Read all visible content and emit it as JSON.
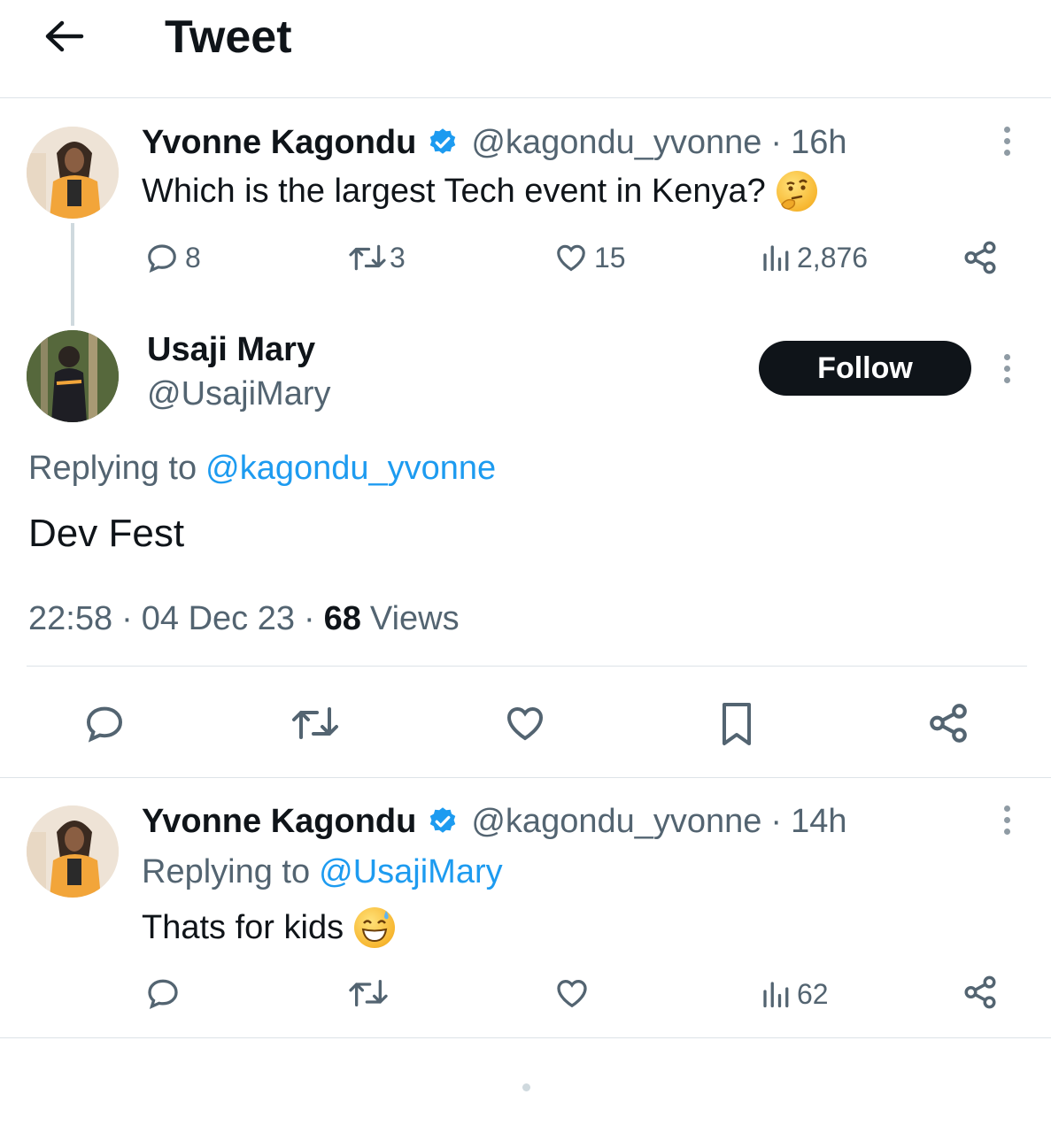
{
  "header": {
    "title": "Tweet"
  },
  "tweet1": {
    "author_name": "Yvonne Kagondu",
    "handle": "@kagondu_yvonne",
    "separator": "·",
    "time": "16h",
    "text": "Which is the largest Tech event in Kenya?",
    "emoji": "thinking-face",
    "replies": "8",
    "retweets": "3",
    "likes": "15",
    "views": "2,876"
  },
  "main_tweet": {
    "author_name": "Usaji Mary",
    "handle": "@UsajiMary",
    "follow_label": "Follow",
    "replying_prefix": "Replying to",
    "replying_handle": "@kagondu_yvonne",
    "text": "Dev Fest",
    "time": "22:58",
    "date": "04 Dec 23",
    "separator": "·",
    "views_count": "68",
    "views_label": "Views"
  },
  "reply": {
    "author_name": "Yvonne Kagondu",
    "handle": "@kagondu_yvonne",
    "separator": "·",
    "time": "14h",
    "replying_prefix": "Replying to",
    "replying_handle": "@UsajiMary",
    "text": "Thats for kids",
    "emoji": "grinning-sweat-face",
    "views": "62"
  },
  "colors": {
    "link": "#1d9bf0",
    "muted": "#536471",
    "text": "#0f1419",
    "verified": "#1d9bf0",
    "divider": "#dde3e8"
  }
}
